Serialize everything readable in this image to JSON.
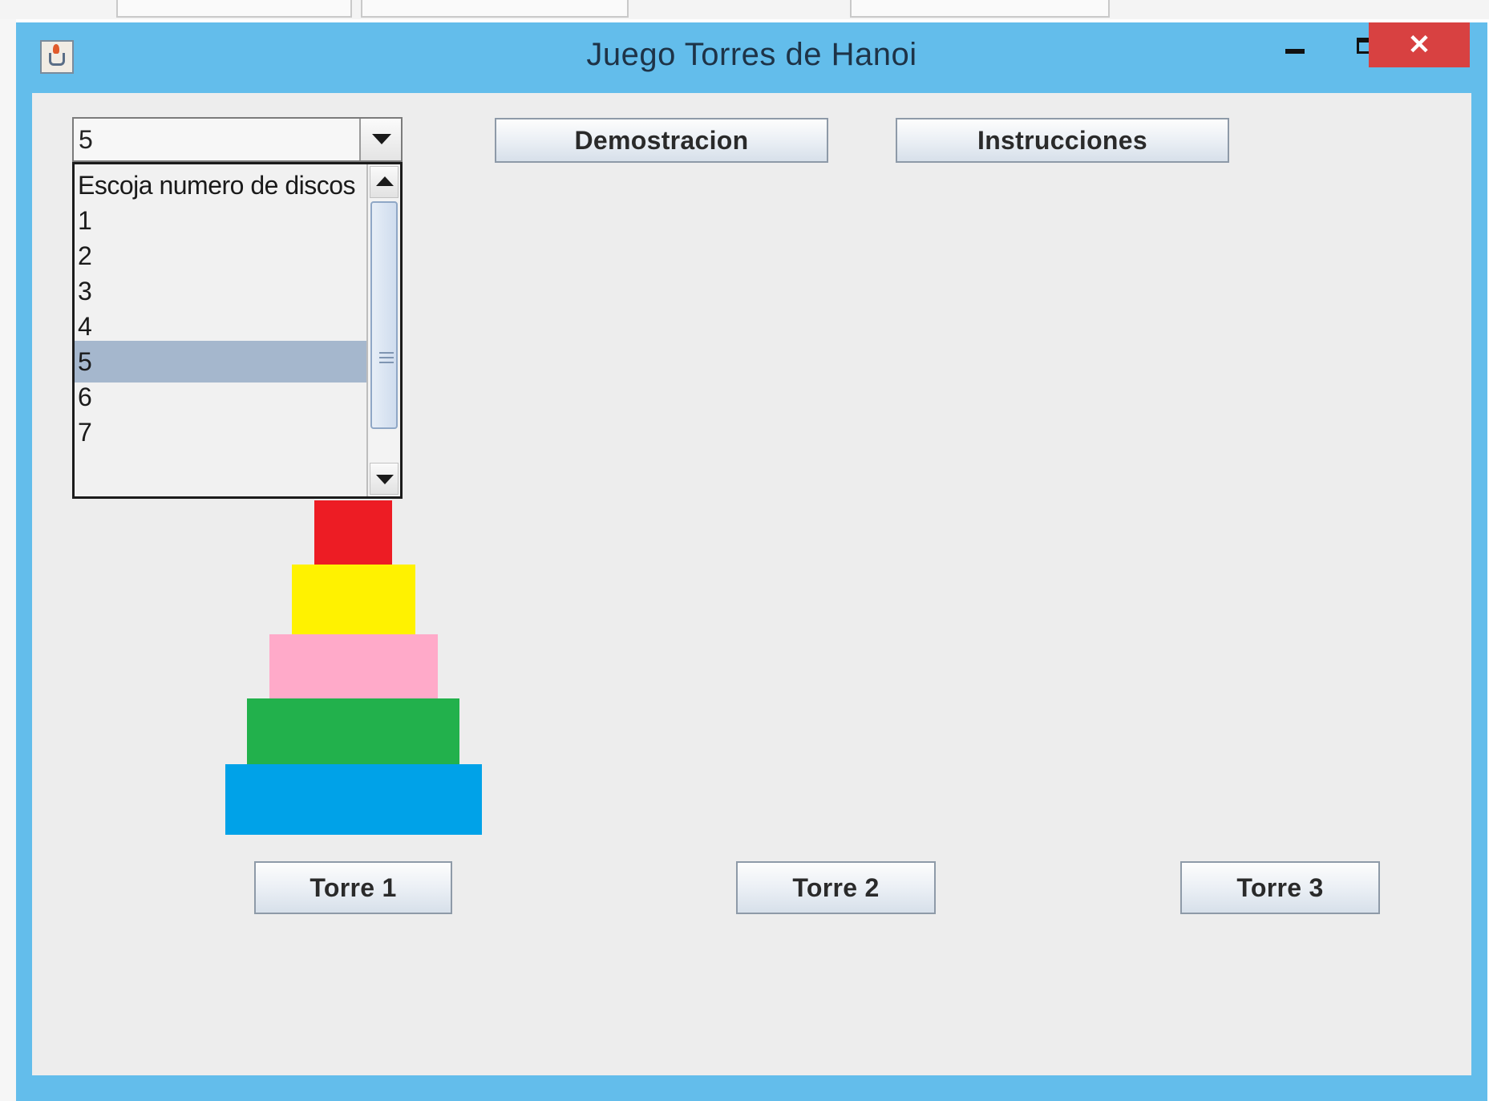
{
  "window": {
    "title": "Juego Torres de Hanoi",
    "close_glyph": "✕"
  },
  "toolbar": {
    "disc_select": {
      "value": "5",
      "options": [
        "Escoja numero de discos",
        "1",
        "2",
        "3",
        "4",
        "5",
        "6",
        "7"
      ],
      "selected_index": 5
    },
    "demo_label": "Demostracion",
    "instructions_label": "Instrucciones"
  },
  "towers": [
    {
      "label": "Torre 1"
    },
    {
      "label": "Torre 2"
    },
    {
      "label": "Torre 3"
    }
  ],
  "discs": [
    {
      "color": "#ed1c24",
      "name": "red"
    },
    {
      "color": "#fff200",
      "name": "yellow"
    },
    {
      "color": "#ffaac9",
      "name": "pink"
    },
    {
      "color": "#22b14c",
      "name": "green"
    },
    {
      "color": "#00a2e8",
      "name": "blue"
    }
  ],
  "colors": {
    "titlebar": "#63bdeb",
    "client_bg": "#ededed",
    "close_button": "#d84141",
    "selection": "#a5b7cd"
  }
}
